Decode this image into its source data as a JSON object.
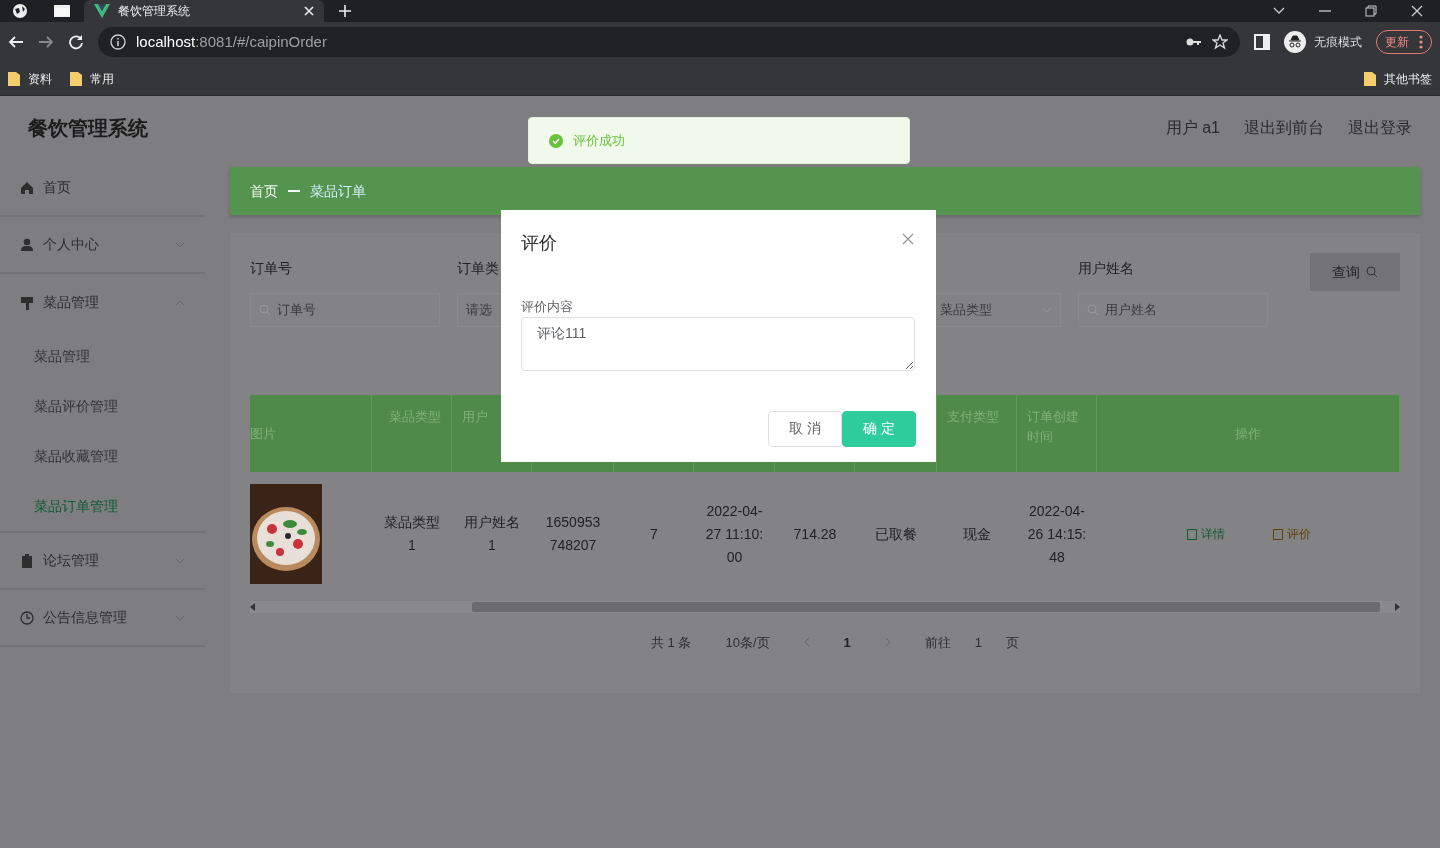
{
  "browser": {
    "tabs": [
      {
        "title": "餐饮管理系统",
        "selected": true
      }
    ],
    "url_host": "localhost",
    "url_path": ":8081/#/caipinOrder",
    "profile_label": "无痕模式",
    "update_button": "更新",
    "bookmarks": [
      "资料",
      "常用"
    ],
    "other_bookmarks": "其他书签"
  },
  "app": {
    "title": "餐饮管理系统",
    "header_links": [
      "用户 a1",
      "退出到前台",
      "退出登录"
    ]
  },
  "sidebar": {
    "items": [
      {
        "label": "首页"
      },
      {
        "label": "个人中心",
        "expanded": false
      },
      {
        "label": "菜品管理",
        "expanded": true,
        "children": [
          {
            "label": "菜品管理",
            "selected": false
          },
          {
            "label": "菜品评价管理",
            "selected": false
          },
          {
            "label": "菜品收藏管理",
            "selected": false
          },
          {
            "label": "菜品订单管理",
            "selected": true
          }
        ]
      },
      {
        "label": "论坛管理",
        "expanded": false
      },
      {
        "label": "公告信息管理",
        "expanded": false
      }
    ]
  },
  "breadcrumb": [
    "首页",
    "菜品订单"
  ],
  "search": {
    "fields": [
      {
        "label": "订单号",
        "placeholder": "订单号",
        "kind": "input"
      },
      {
        "label": "订单类",
        "placeholder": "请选",
        "kind": "select"
      },
      {
        "placeholder": "菜品类型",
        "kind": "select"
      },
      {
        "label": "用户姓名",
        "placeholder": "用户姓名",
        "kind": "input"
      }
    ],
    "button": "查询"
  },
  "table": {
    "columns": [
      "图片",
      "菜品类型",
      "用户",
      null,
      null,
      null,
      null,
      null,
      "支付类型",
      "订单创建时间",
      "操作"
    ],
    "rows": [
      {
        "cells": [
          {
            "kind": "picture"
          },
          "菜品类型1",
          "用户姓名1",
          "1650953748207",
          "7",
          "2022-04-27 11:10:00",
          "714.28",
          "已取餐",
          "现金",
          "2022-04-26 14:15:48",
          {
            "actions": [
              {
                "label": "详情",
                "kind": "detail"
              },
              {
                "label": "评价",
                "kind": "review"
              }
            ]
          }
        ]
      }
    ]
  },
  "pagination": {
    "total": "共 1 条",
    "page_size": "10条/页",
    "pages": [
      {
        "label": "1",
        "selected": true
      }
    ],
    "goto_label": "前往",
    "goto_value": "1",
    "goto_suffix": "页"
  },
  "toast": {
    "text": "评价成功",
    "kind": "success"
  },
  "modal": {
    "title": "评价",
    "field_label": "评价内容",
    "value": "评论111",
    "buttons": [
      {
        "label": "取 消",
        "kind": "secondary"
      },
      {
        "label": "确 定",
        "kind": "primary"
      }
    ]
  }
}
